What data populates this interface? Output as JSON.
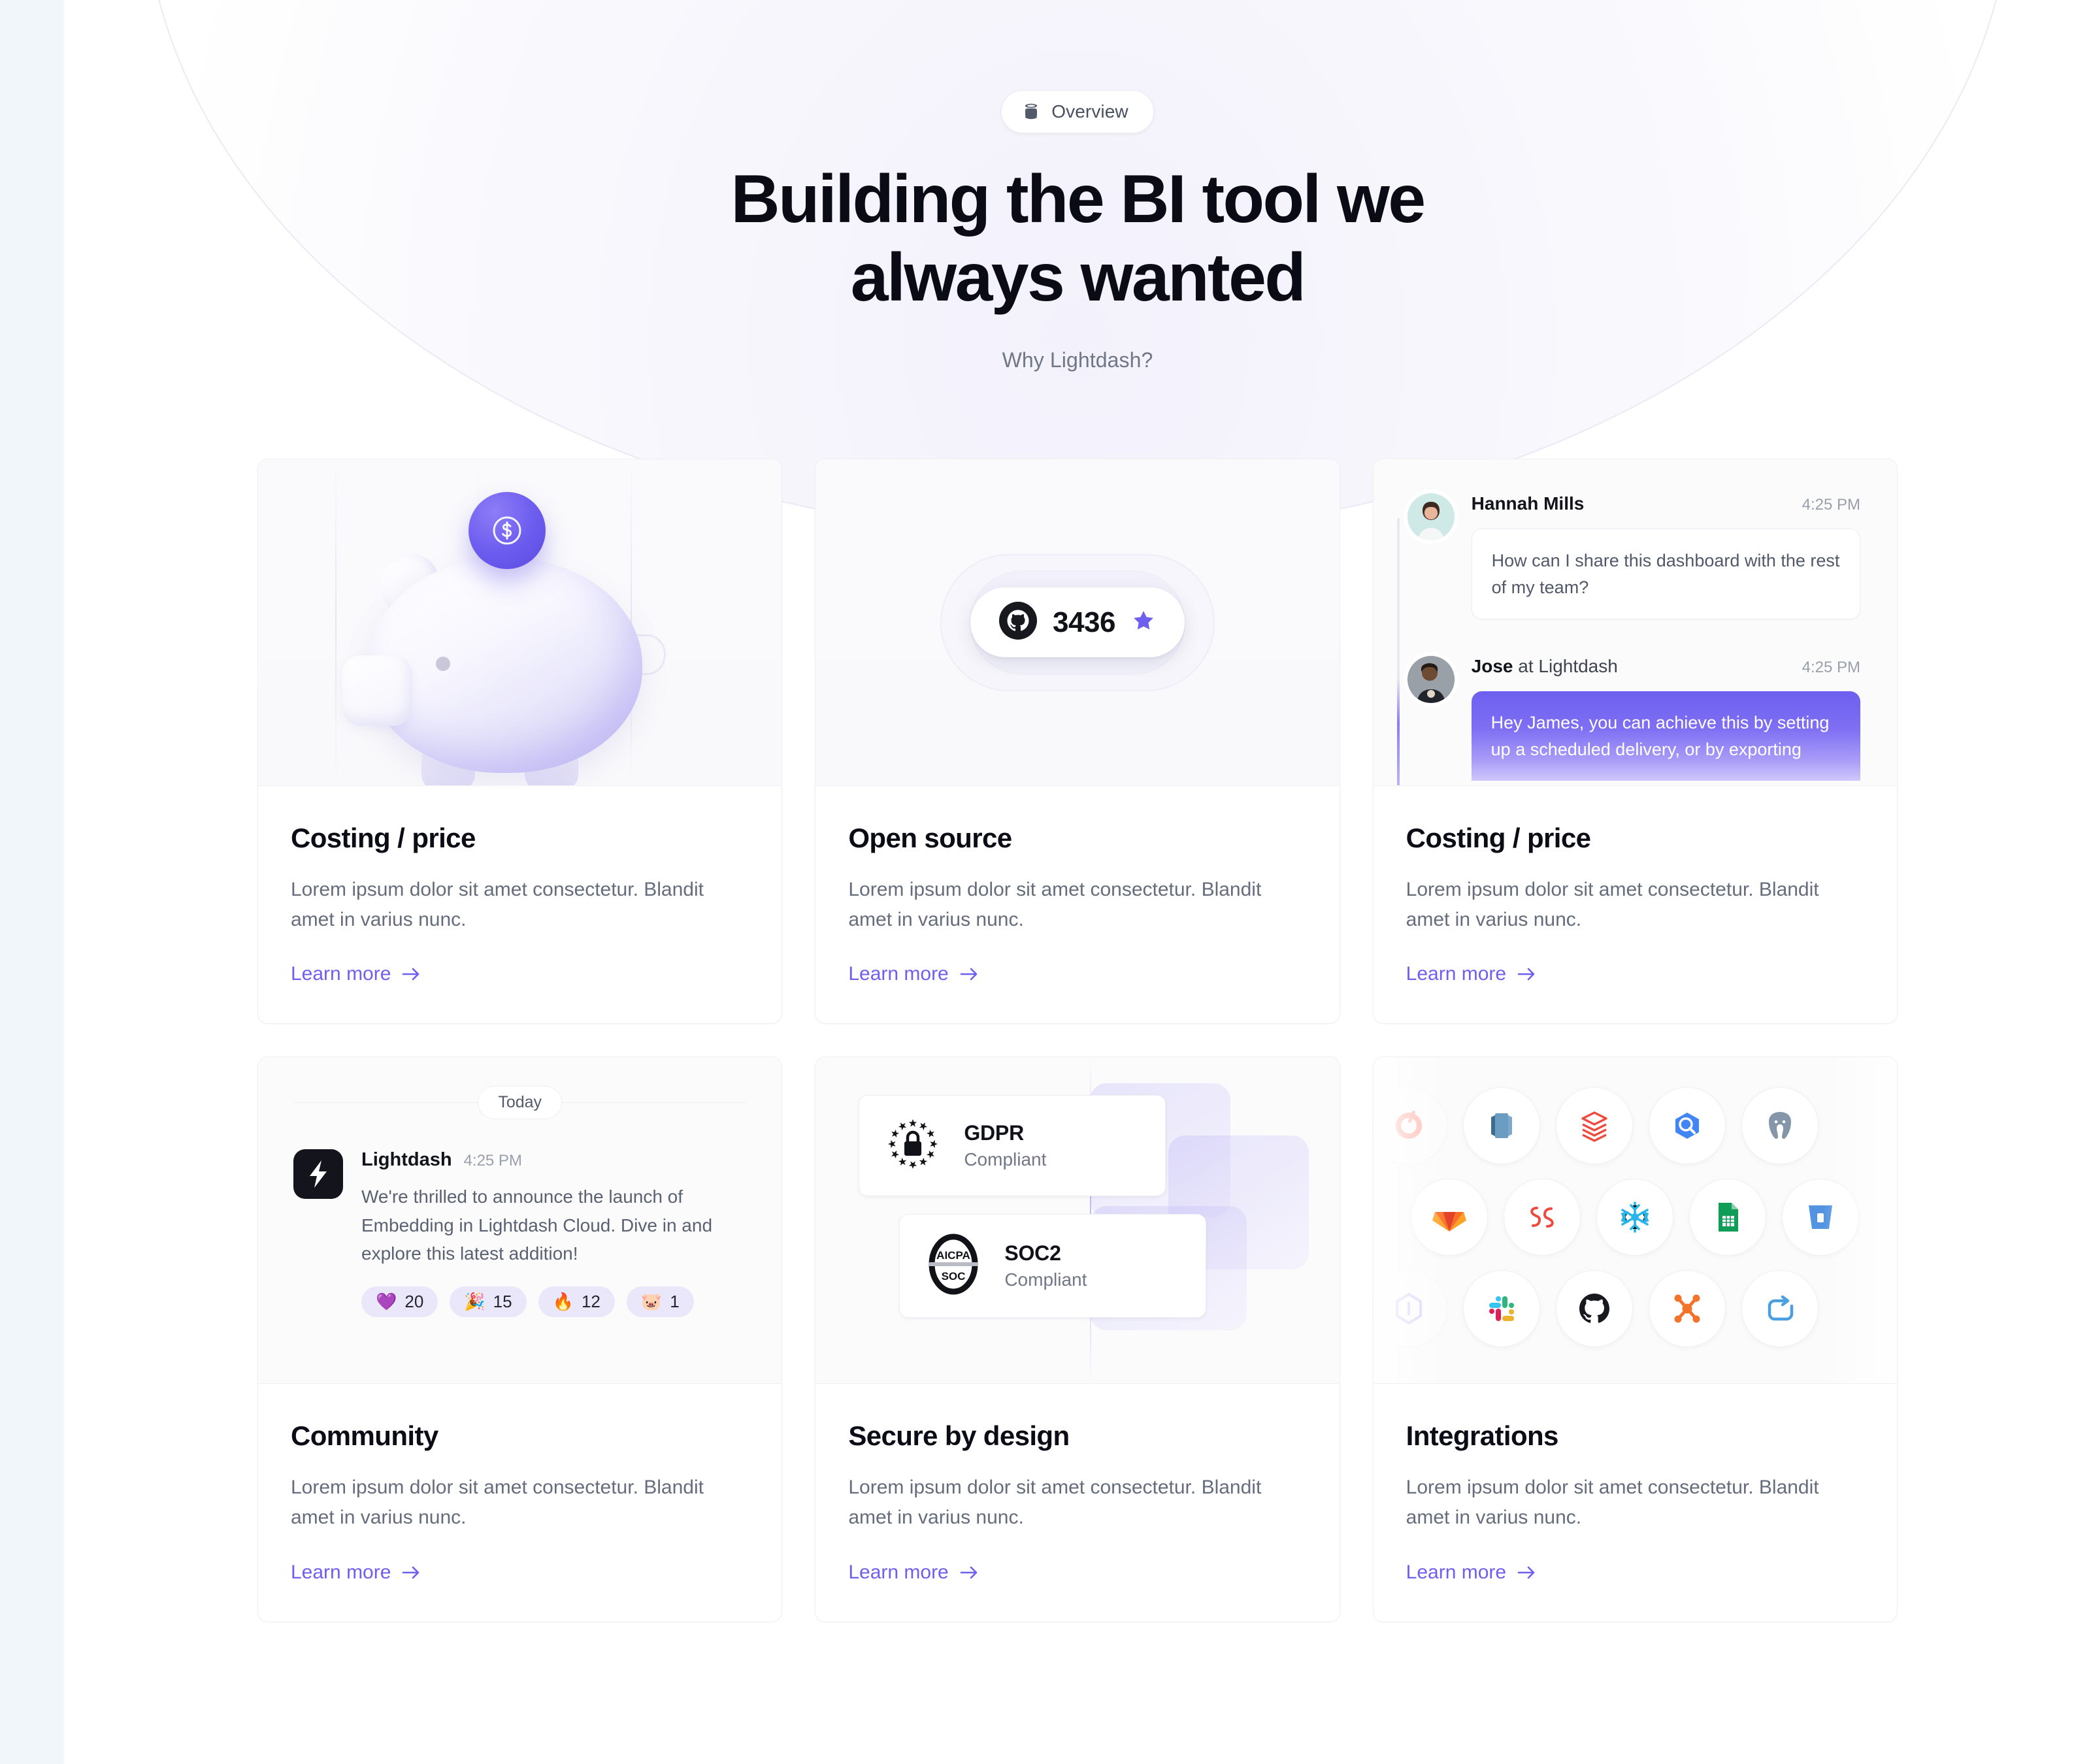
{
  "colors": {
    "accent": "#6f5ff0",
    "page_bg": "#f1f6fa",
    "surface": "#ffffff",
    "title": "#0a0b14",
    "body_text": "#656d7d"
  },
  "hero": {
    "eyebrow": {
      "icon": "database-icon",
      "label": "Overview"
    },
    "headline_line1": "Building the BI tool we",
    "headline_line2": "always wanted",
    "subhead": "Why Lightdash?"
  },
  "cards": [
    {
      "id": "costing-price",
      "title": "Costing / price",
      "description": "Lorem ipsum dolor sit amet consectetur. Blandit amet in varius nunc.",
      "link_label": "Learn more",
      "media": "piggy-bank-illustration",
      "coin_icon": "dollar-coin-icon"
    },
    {
      "id": "open-source",
      "title": "Open source",
      "description": "Lorem ipsum dolor sit amet consectetur. Blandit amet in varius nunc.",
      "link_label": "Learn more",
      "media": "github-stars-badge",
      "github": {
        "icon": "github-icon",
        "stars": "3436",
        "star_icon": "star-icon"
      }
    },
    {
      "id": "costing-price-chat",
      "title": "Costing / price",
      "description": "Lorem ipsum dolor sit amet consectetur. Blandit amet in varius nunc.",
      "link_label": "Learn more",
      "media": "support-chat-thread",
      "chat": [
        {
          "author": "Hannah Mills",
          "author_suffix": "",
          "time": "4:25 PM",
          "message": "How can I share this dashboard with the rest of my team?",
          "style": "light"
        },
        {
          "author": "Jose",
          "author_suffix": " at Lightdash",
          "time": "4:25 PM",
          "message": "Hey James, you can achieve this by setting up a scheduled delivery, or by exporting",
          "style": "purple"
        }
      ]
    },
    {
      "id": "community",
      "title": "Community",
      "description": "Lorem ipsum dolor sit amet consectetur. Blandit amet in varius nunc.",
      "link_label": "Learn more",
      "media": "slack-announcement",
      "slack": {
        "day_separator": "Today",
        "logo_icon": "lightdash-bolt-icon",
        "author": "Lightdash",
        "time": "4:25 PM",
        "message": "We're thrilled to announce the launch of Embedding in Lightdash Cloud. Dive in and explore this latest addition!",
        "reactions": [
          {
            "emoji": "💜",
            "name": "purple-heart-emoji",
            "count": "20"
          },
          {
            "emoji": "🎉",
            "name": "party-popper-emoji",
            "count": "15"
          },
          {
            "emoji": "🔥",
            "name": "fire-emoji",
            "count": "12"
          },
          {
            "emoji": "🐷",
            "name": "pig-face-emoji",
            "count": "1"
          }
        ]
      }
    },
    {
      "id": "secure-by-design",
      "title": "Secure by design",
      "description": "Lorem ipsum dolor sit amet consectetur. Blandit amet in varius nunc.",
      "link_label": "Learn more",
      "media": "compliance-badges",
      "badges": [
        {
          "icon": "gdpr-lock-stars-icon",
          "title": "GDPR",
          "status": "Compliant"
        },
        {
          "icon": "aicpa-soc-icon",
          "title": "SOC2",
          "status": "Compliant"
        }
      ]
    },
    {
      "id": "integrations",
      "title": "Integrations",
      "description": "Lorem ipsum dolor sit amet consectetur. Blandit amet in varius nunc.",
      "link_label": "Learn more",
      "media": "integration-logo-grid",
      "integrations_rows": [
        [
          {
            "name": "dbt-icon",
            "glyph": "◔",
            "color": "#ff694a",
            "ghost": true
          },
          {
            "name": "redshift-icon",
            "glyph": "▮",
            "color": "#6c9fd1",
            "ghost": false
          },
          {
            "name": "databricks-icon",
            "glyph": "⬟",
            "color": "#ef4a3f",
            "ghost": false
          },
          {
            "name": "bigquery-icon",
            "glyph": "⬢",
            "color": "#4285f4",
            "ghost": false
          },
          {
            "name": "postgresql-icon",
            "glyph": "ὁ8",
            "color": "#7e93a6",
            "ghost": false
          }
        ],
        [
          {
            "name": "gitlab-icon",
            "glyph": "▼",
            "color": "#fc6d26",
            "ghost": false
          },
          {
            "name": "dagster-icon",
            "glyph": "∞",
            "color": "#ef4a3f",
            "ghost": false
          },
          {
            "name": "snowflake-icon",
            "glyph": "❄",
            "color": "#29b5e8",
            "ghost": false
          },
          {
            "name": "google-sheets-icon",
            "glyph": "▦",
            "color": "#0f9d58",
            "ghost": false
          },
          {
            "name": "trino-icon",
            "glyph": "▽",
            "color": "#5294e2",
            "ghost": false
          }
        ],
        [
          {
            "name": "prefect-icon",
            "glyph": "◇",
            "color": "#b6a8f5",
            "ghost": true
          },
          {
            "name": "slack-icon",
            "glyph": "✥",
            "color": "#4a154b",
            "ghost": false
          },
          {
            "name": "github-icon",
            "glyph": "●",
            "color": "#17191f",
            "ghost": false
          },
          {
            "name": "airbyte-icon",
            "glyph": "✖",
            "color": "#f4732a",
            "ghost": false
          },
          {
            "name": "azure-devops-icon",
            "glyph": "↻",
            "color": "#4a9fe0",
            "ghost": false
          }
        ]
      ]
    }
  ]
}
